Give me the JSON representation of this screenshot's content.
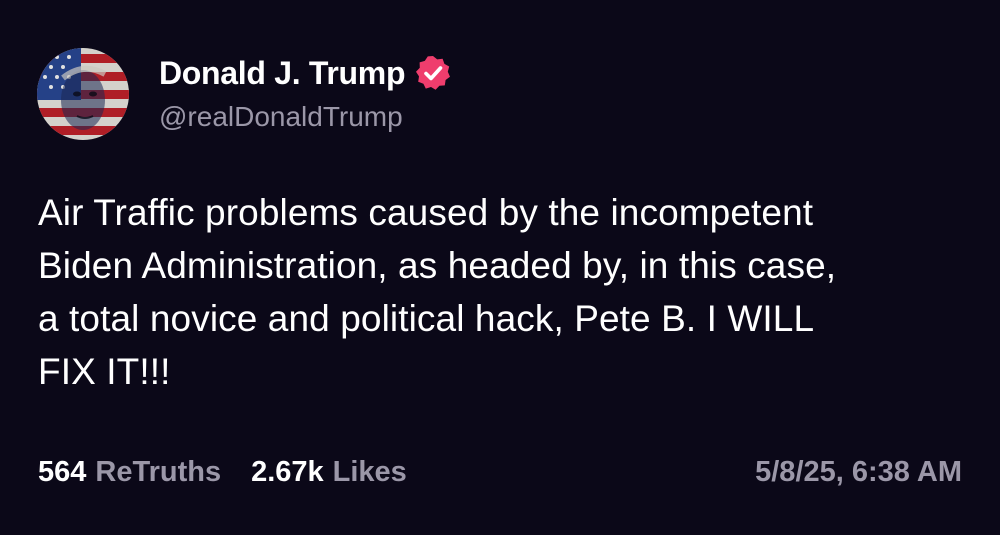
{
  "profile": {
    "display_name": "Donald J. Trump",
    "handle": "@realDonaldTrump",
    "avatar_icon": "flag-portrait-avatar",
    "verified_icon": "verified-badge-icon",
    "verified_color": "#ef3d6d"
  },
  "post": {
    "text": "Air Traffic problems caused by the incompetent\nBiden Administration, as headed by, in this case,\na total novice and political hack, Pete B. I WILL\nFIX IT!!!"
  },
  "stats": {
    "retruths_count": "564",
    "retruths_label": "ReTruths",
    "likes_count": "2.67k",
    "likes_label": "Likes",
    "timestamp": "5/8/25, 6:38 AM"
  },
  "colors": {
    "background": "#0b0818",
    "primary_text": "#ffffff",
    "secondary_text": "#9b97a8"
  }
}
